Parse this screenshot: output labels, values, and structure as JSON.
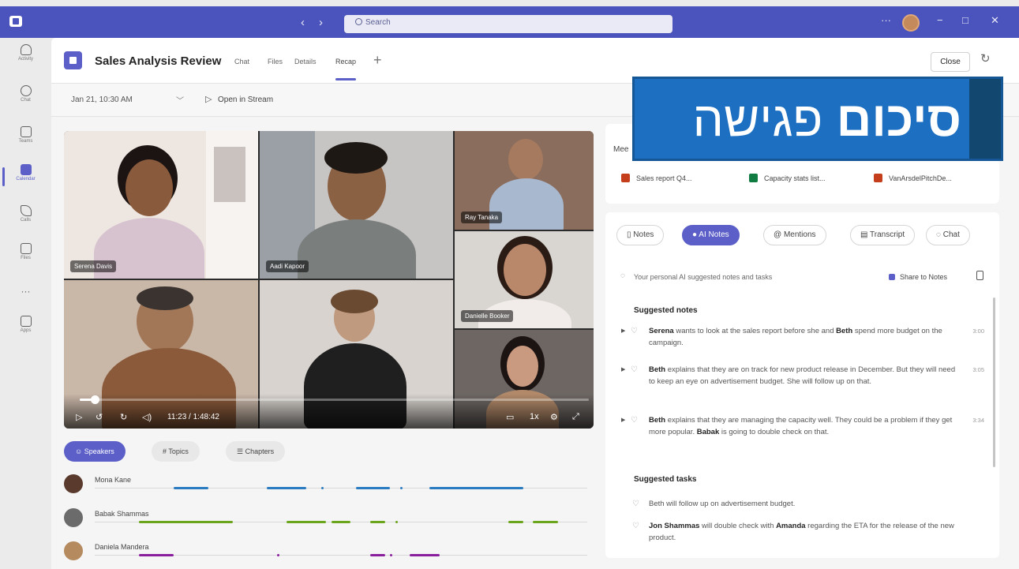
{
  "titlebar": {
    "back_icon": "chevron-left-icon",
    "forward_icon": "chevron-right-icon",
    "search_placeholder": "Search",
    "more_label": "···",
    "window_controls": [
      "−",
      "□",
      "✕"
    ]
  },
  "rail": {
    "items": [
      {
        "label": "Activity",
        "icon": "bell-icon"
      },
      {
        "label": "Chat",
        "icon": "chat-icon"
      },
      {
        "label": "Teams",
        "icon": "teams-icon"
      },
      {
        "label": "Calendar",
        "icon": "calendar-icon",
        "active": true
      },
      {
        "label": "Calls",
        "icon": "phone-icon"
      },
      {
        "label": "Files",
        "icon": "file-icon"
      },
      {
        "label": "···",
        "icon": "more-icon"
      },
      {
        "label": "Apps",
        "icon": "apps-icon"
      }
    ]
  },
  "header": {
    "meeting_title": "Sales Analysis Review",
    "tabs": [
      {
        "label": "Chat"
      },
      {
        "label": "Files"
      },
      {
        "label": "Details"
      },
      {
        "label": "Recap",
        "active": true
      }
    ],
    "add_tab": "+",
    "close_label": "Close"
  },
  "datebar": {
    "date": "Jan 21, 10:30 AM",
    "chevron": "﹀",
    "open_in_stream": "Open in Stream"
  },
  "banner": {
    "bold": "סיכום",
    "regular": "פגישה"
  },
  "video": {
    "participants": [
      {
        "name": "Serena Davis"
      },
      {
        "name": "Aadi Kapoor"
      },
      {
        "name": "Ray Tanaka"
      },
      {
        "name": "Danielle Booker"
      }
    ],
    "progress": 0.03,
    "time": "11:23 / 1:48:42",
    "speed": "1x"
  },
  "speakers": {
    "tabs": [
      {
        "label": "Speakers",
        "active": true
      },
      {
        "label": "# Topics"
      },
      {
        "label": "☰ Chapters"
      }
    ],
    "rows": [
      {
        "name": "Mona Kane",
        "color": "#2a7bc0",
        "segments": [
          [
            0.16,
            0.23
          ],
          [
            0.35,
            0.43
          ],
          [
            0.53,
            0.6
          ],
          [
            0.68,
            0.87
          ]
        ],
        "dots": [
          0.46,
          0.62
        ]
      },
      {
        "name": "Babak Shammas",
        "color": "#6aa51c",
        "segments": [
          [
            0.09,
            0.28
          ],
          [
            0.39,
            0.47
          ],
          [
            0.48,
            0.52
          ],
          [
            0.56,
            0.59
          ],
          [
            0.84,
            0.87
          ],
          [
            0.89,
            0.94
          ]
        ],
        "dots": [
          0.61
        ]
      },
      {
        "name": "Daniela Mandera",
        "color": "#8a1f9e",
        "segments": [
          [
            0.09,
            0.16
          ],
          [
            0.56,
            0.59
          ],
          [
            0.64,
            0.7
          ]
        ],
        "dots": [
          0.37,
          0.6
        ]
      }
    ]
  },
  "files": {
    "heading": "Mee",
    "items": [
      {
        "name": "Sales report Q4...",
        "color": "#c43e1c"
      },
      {
        "name": "Capacity stats list...",
        "color": "#107c41"
      },
      {
        "name": "VanArsdelPitchDe...",
        "color": "#c43e1c"
      }
    ]
  },
  "notes": {
    "tabs": [
      {
        "label": "Notes",
        "icon": "notes-icon"
      },
      {
        "label": "AI Notes",
        "icon": "bulb-icon",
        "active": true
      },
      {
        "label": "Mentions",
        "icon": "at-icon"
      },
      {
        "label": "Transcript",
        "icon": "transcript-icon"
      },
      {
        "label": "Chat",
        "icon": "chat-icon"
      }
    ],
    "hint": "Your personal AI suggested notes and tasks",
    "share": "Share to Notes",
    "suggested_notes_title": "Suggested notes",
    "suggested_notes": [
      {
        "parts": [
          {
            "b": "Serena"
          },
          {
            "t": " wants to look at the sales report before she and "
          },
          {
            "b": "Beth"
          },
          {
            "t": " spend more budget on the campaign."
          }
        ],
        "time": "3:00"
      },
      {
        "parts": [
          {
            "b": "Beth"
          },
          {
            "t": " explains that they are on track for new product release in December. But they will need to keep an eye on advertisement budget. She will follow up on that."
          }
        ],
        "time": "3:05"
      },
      {
        "parts": [
          {
            "b": "Beth"
          },
          {
            "t": " explains that they are managing the capacity well. They could be a problem if they get more popular. "
          },
          {
            "b": "Babak"
          },
          {
            "t": " is going to double check on that."
          }
        ],
        "time": "3:34"
      }
    ],
    "suggested_tasks_title": "Suggested tasks",
    "suggested_tasks": [
      {
        "parts": [
          {
            "t": "Beth will follow up on advertisement budget."
          }
        ]
      },
      {
        "parts": [
          {
            "b": "Jon Shammas"
          },
          {
            "t": " will double check with "
          },
          {
            "b": "Amanda"
          },
          {
            "t": " regarding the ETA for the release of the new product."
          }
        ]
      }
    ]
  }
}
